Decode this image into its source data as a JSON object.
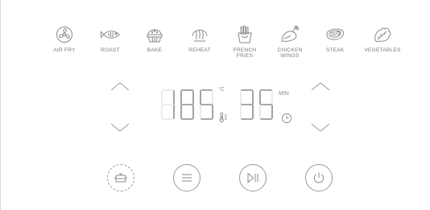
{
  "modes": [
    {
      "label": "AIR FRY",
      "icon": "fan-icon"
    },
    {
      "label": "ROAST",
      "icon": "fish-icon"
    },
    {
      "label": "BAKE",
      "icon": "cake-icon"
    },
    {
      "label": "REHEAT",
      "icon": "heat-waves-icon"
    },
    {
      "label": "FRENCH\nFRIES",
      "icon": "fries-icon"
    },
    {
      "label": "CHICKEN\nWINGS",
      "icon": "chicken-leg-icon"
    },
    {
      "label": "STEAK",
      "icon": "steak-icon"
    },
    {
      "label": "VEGETABLES",
      "icon": "vegetables-icon"
    }
  ],
  "display": {
    "temperature": "185",
    "temperature_unit": "°C",
    "time": "35",
    "time_unit": "MIN"
  },
  "colors": {
    "lit": "#8c8c8c",
    "unlit": "#e6e6e6",
    "outline": "#9a9a9a"
  },
  "controls": [
    {
      "name": "basket-button",
      "icon": "basket-icon"
    },
    {
      "name": "menu-button",
      "icon": "menu-icon"
    },
    {
      "name": "play-pause-button",
      "icon": "play-pause-icon"
    },
    {
      "name": "power-button",
      "icon": "power-icon"
    }
  ]
}
